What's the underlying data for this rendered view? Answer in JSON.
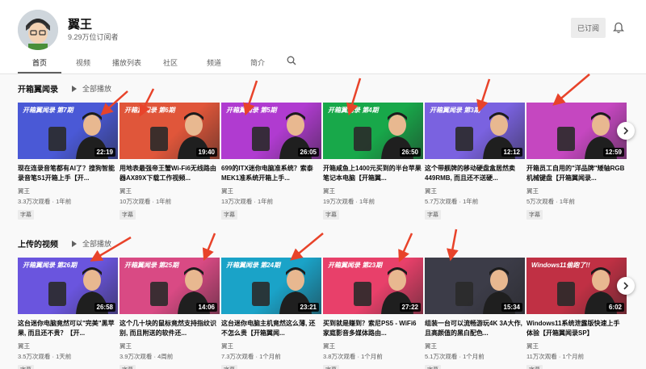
{
  "channel": {
    "name": "翼王",
    "subscribers": "9.29万位订阅者",
    "subscribed_label": "已订阅"
  },
  "tabs": [
    {
      "label": "首页",
      "active": true
    },
    {
      "label": "视频",
      "active": false
    },
    {
      "label": "播放列表",
      "active": false
    },
    {
      "label": "社区",
      "active": false
    },
    {
      "label": "频道",
      "active": false
    },
    {
      "label": "简介",
      "active": false
    }
  ],
  "sections": [
    {
      "title": "开箱翼闻录",
      "play_all": "全部播放",
      "videos": [
        {
          "thumb_text": "开箱翼闻录 第7期",
          "duration": "22:19",
          "title": "现在连录音笔都有AI了？搜狗智能录音笔S1开箱上手【开...",
          "author": "翼王",
          "meta": "3.3万次观看 · 1年前",
          "badge": "字幕",
          "bg": "#4a59d6"
        },
        {
          "thumb_text": "开箱翼闻录 第6期",
          "duration": "19:40",
          "title": "用地表最强帝王蟹Wi-Fi6无线路由器AX89X下载工作视频...",
          "author": "翼王",
          "meta": "10万次观看 · 1年前",
          "badge": "字幕",
          "bg": "#e0563a"
        },
        {
          "thumb_text": "开箱翼闻录 第5期",
          "duration": "26:05",
          "title": "699的ITX迷你电脑准系统？索泰MEK1准系统开箱上手...",
          "author": "翼王",
          "meta": "13万次观看 · 1年前",
          "badge": "字幕",
          "bg": "#b03bd0"
        },
        {
          "thumb_text": "开箱翼闻录 第4期",
          "duration": "26:50",
          "title": "开箱咸鱼上1400元买到的半台苹果笔记本电脑【开箱翼...",
          "author": "翼王",
          "meta": "19万次观看 · 1年前",
          "badge": "字幕",
          "bg": "#18a84a"
        },
        {
          "thumb_text": "开箱翼闻录 第3期",
          "duration": "12:12",
          "title": "这个带舰牌的移动硬盘盒居然卖449RMB, 而且还不送硬...",
          "author": "翼王",
          "meta": "5.7万次观看 · 1年前",
          "badge": "字幕",
          "bg": "#7a62e0"
        },
        {
          "thumb_text": "",
          "duration": "12:59",
          "title": "开箱员工自用的\"洋品牌\"矮轴RGB机械键盘【开箱翼闻录...",
          "author": "翼王",
          "meta": "5万次观看 · 1年前",
          "badge": "字幕",
          "bg": "#c547c0"
        }
      ]
    },
    {
      "title": "上传的视频",
      "play_all": "全部播放",
      "videos": [
        {
          "thumb_text": "开箱翼闻录 第26期",
          "duration": "26:58",
          "title": "这台迷你电脑竟然可以\"完美\"黑苹果, 而且还不贵？【开...",
          "author": "翼王",
          "meta": "3.5万次观看 · 1天前",
          "badge": "字幕",
          "bg": "#6a55de"
        },
        {
          "thumb_text": "开箱翼闻录 第25期",
          "duration": "14:06",
          "title": "这个几十块的鼠标竟然支持指纹识别, 而且附送的软件还...",
          "author": "翼王",
          "meta": "3.9万次观看 · 4周前",
          "badge": "字幕",
          "bg": "#d94a84"
        },
        {
          "thumb_text": "开箱翼闻录 第24期",
          "duration": "23:21",
          "title": "这台迷你电脑主机竟然这么薄, 还不怎么贵【开箱翼闻...",
          "author": "翼王",
          "meta": "7.3万次观看 · 1个月前",
          "badge": "字幕",
          "bg": "#1aa3c8"
        },
        {
          "thumb_text": "开箱翼闻录 第23期",
          "duration": "27:22",
          "title": "买到就是赚到？索尼PS5 - WiFi6家庭影音多媒体路由...",
          "author": "翼王",
          "meta": "3.8万次观看 · 1个月前",
          "badge": "字幕",
          "bg": "#e8406a"
        },
        {
          "thumb_text": "",
          "duration": "15:34",
          "title": "组装一台可以流畅游玩4K 3A大作, 且高颜值的黑白配色...",
          "author": "翼王",
          "meta": "5.1万次观看 · 1个月前",
          "badge": "字幕",
          "bg": "#3c3c48"
        },
        {
          "thumb_text": "Windows11偷跑了!!",
          "duration": "6:02",
          "title": "Windows11系统泄露版快速上手体验【开箱翼闻录SP】",
          "author": "翼王",
          "meta": "11万次观看 · 1个月前",
          "badge": "字幕",
          "bg": "#c03044"
        }
      ]
    }
  ],
  "icons": {
    "search": "search-icon",
    "bell": "bell-icon",
    "next": "chevron-right-icon"
  },
  "colors": {
    "annotation_arrow": "#e8432a",
    "subtext": "#606060"
  }
}
